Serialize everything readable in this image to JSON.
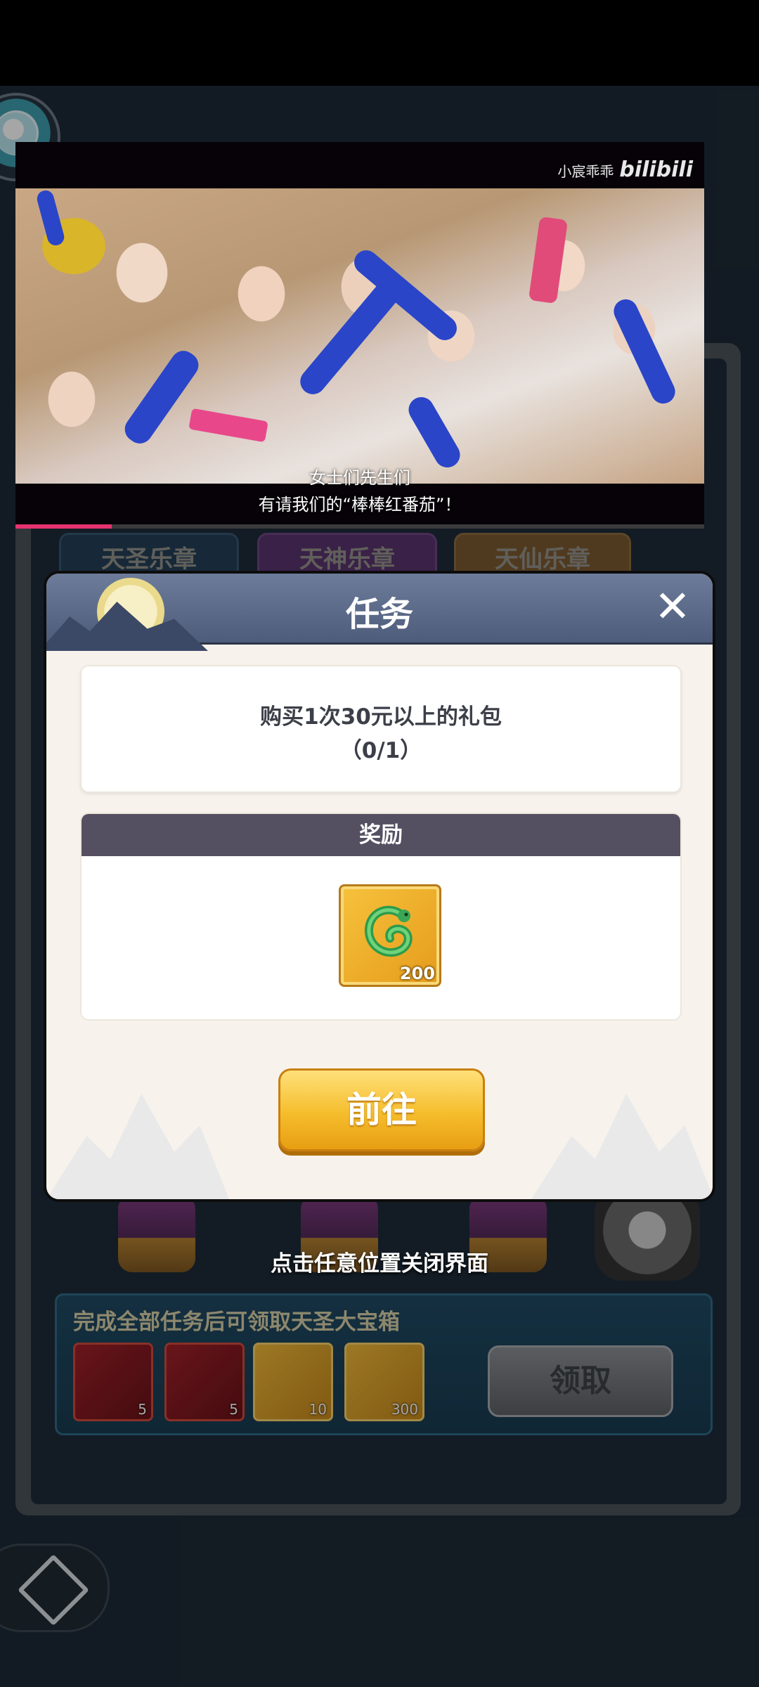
{
  "video": {
    "watermark_user": "小宸乖乖",
    "watermark_brand": "bilibili",
    "subtitle_line1": "女士们先生们",
    "subtitle_line2": "有请我们的“棒棒红番茄”！",
    "progress_fraction": 0.14
  },
  "tabs": [
    "天圣乐章",
    "天神乐章",
    "天仙乐章"
  ],
  "modal": {
    "title": "任务",
    "close_glyph": "✕",
    "task_text": "购买1次30元以上的礼包",
    "task_progress": "（0/1）",
    "reward_header": "奖励",
    "reward_item_count": "200",
    "go_button": "前往"
  },
  "background": {
    "close_hint": "点击任意位置关闭界面",
    "reward_panel_title": "完成全部任务后可领取天圣大宝箱",
    "panel_items": [
      {
        "icon": "puzzle-piece-icon",
        "count": "5"
      },
      {
        "icon": "mystery-puzzle-icon",
        "count": "5"
      },
      {
        "icon": "token-coin-icon",
        "count": "10"
      },
      {
        "icon": "jade-dragon-icon",
        "count": "300"
      }
    ],
    "claim_button": "领取"
  },
  "colors": {
    "accent_progress": "#e5336f",
    "modal_header": "#5a6888",
    "go_button": "#f5bd2c"
  }
}
